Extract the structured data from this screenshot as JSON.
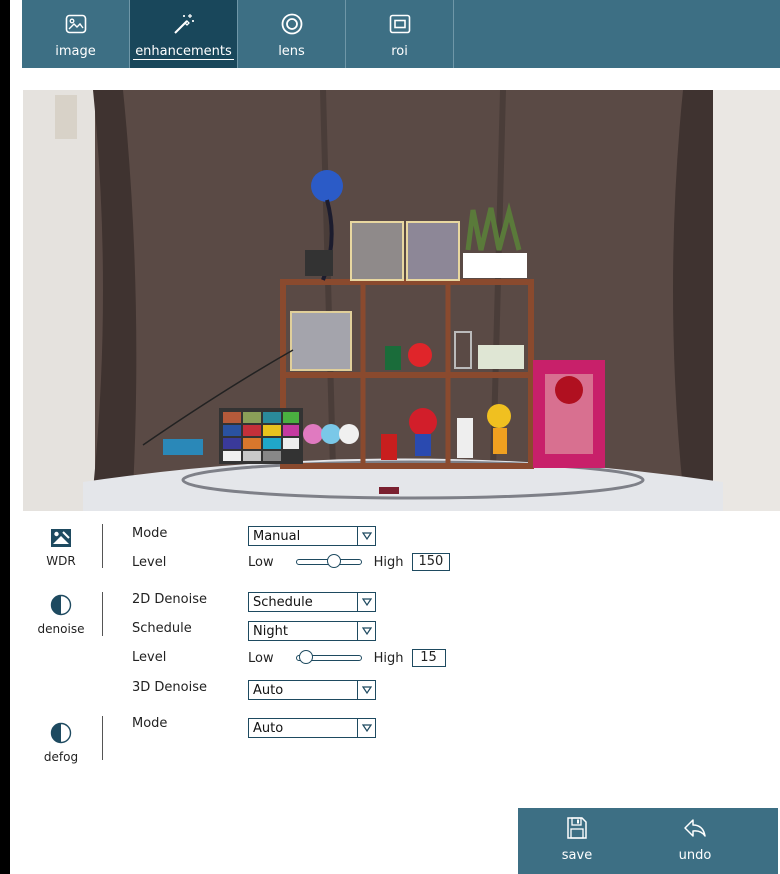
{
  "tabs": [
    {
      "label": "image",
      "icon": "image-icon",
      "active": false
    },
    {
      "label": "enhancements",
      "icon": "magic-wand-icon",
      "active": true
    },
    {
      "label": "lens",
      "icon": "lens-icon",
      "active": false
    },
    {
      "label": "roi",
      "icon": "roi-icon",
      "active": false
    }
  ],
  "preview": {
    "icon": "camera-preview-image"
  },
  "wdr": {
    "group_label": "WDR",
    "icon": "wdr-icon",
    "mode_label": "Mode",
    "mode_value": "Manual",
    "level_label": "Level",
    "level_low": "Low",
    "level_high": "High",
    "level_value": "150",
    "level_fraction": 0.59
  },
  "denoise": {
    "group_label": "denoise",
    "icon": "denoise-icon",
    "denoise2d_label": "2D Denoise",
    "denoise2d_value": "Schedule",
    "schedule_label": "Schedule",
    "schedule_value": "Night",
    "level_label": "Level",
    "level_low": "Low",
    "level_high": "High",
    "level_value": "15",
    "level_fraction": 0.15,
    "denoise3d_label": "3D Denoise",
    "denoise3d_value": "Auto"
  },
  "defog": {
    "group_label": "defog",
    "icon": "defog-icon",
    "mode_label": "Mode",
    "mode_value": "Auto"
  },
  "actions": {
    "save_label": "save",
    "undo_label": "undo"
  },
  "colors": {
    "bar": "#3d6f84",
    "bar_active": "#19475b",
    "control_border": "#1e4a60"
  }
}
